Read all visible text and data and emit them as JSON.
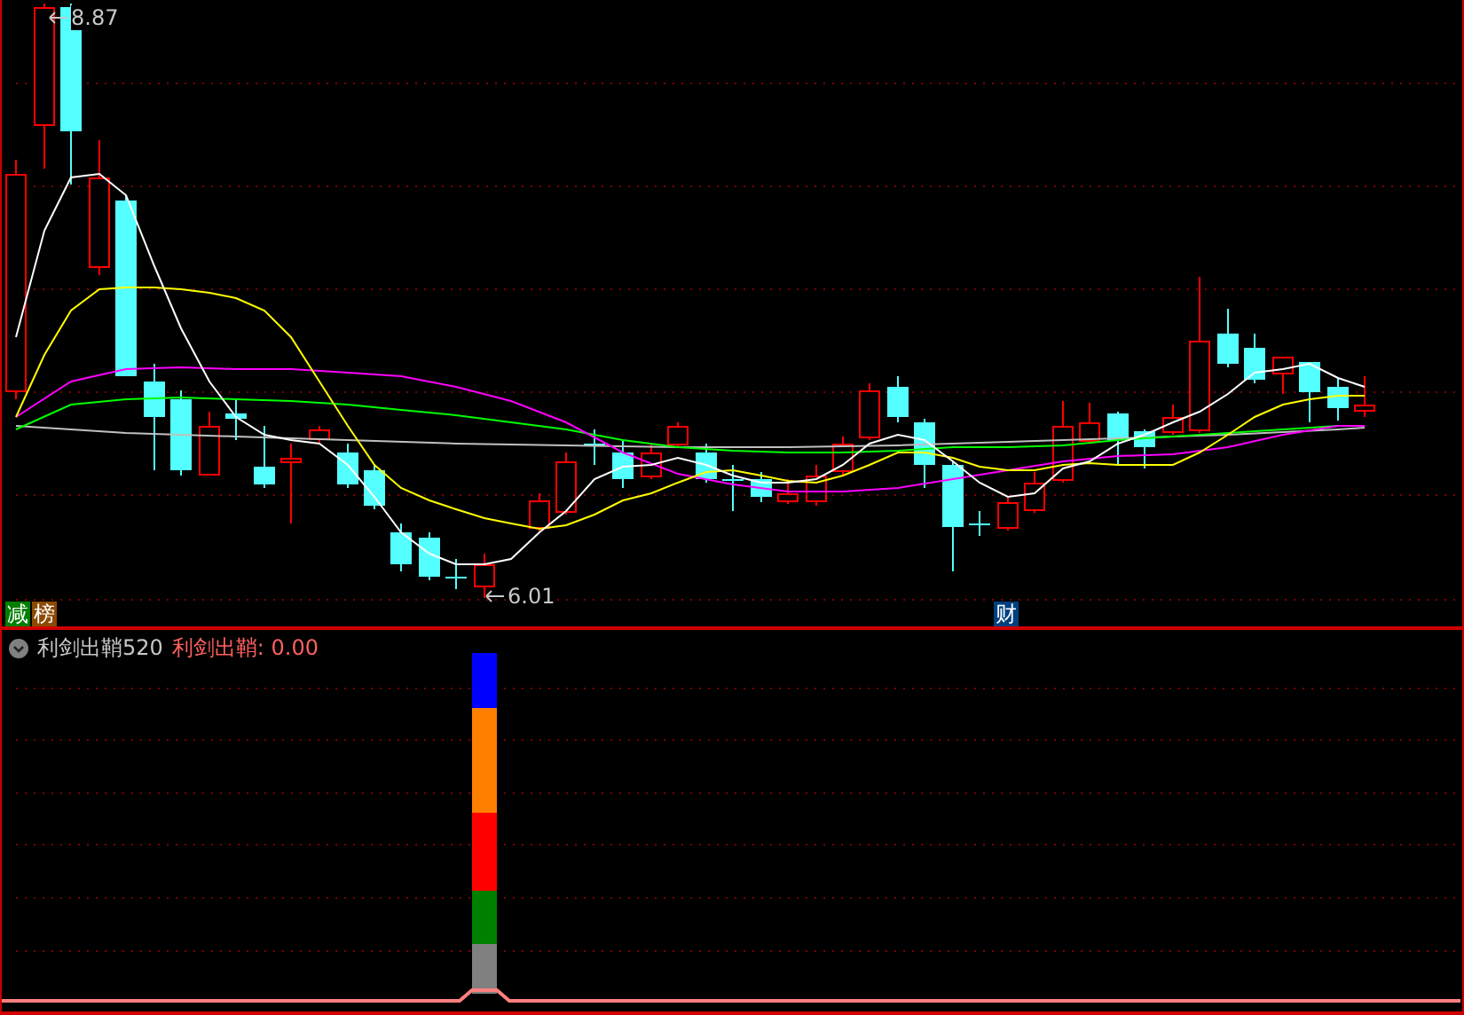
{
  "price_chart": {
    "high_label": "8.87",
    "low_label": "6.01",
    "badges": [
      {
        "text": "减",
        "color": "#007f00"
      },
      {
        "text": "榜",
        "color": "#8c4a00"
      }
    ],
    "event_marker": {
      "text": "财",
      "color": "#00407f"
    }
  },
  "indicator": {
    "name": "利剑出鞘520",
    "value_label": "利剑出鞘: 0.00",
    "stack": [
      {
        "color": "#0000ff"
      },
      {
        "color": "#ff8000"
      },
      {
        "color": "#ff0000"
      },
      {
        "color": "#008000"
      },
      {
        "color": "#808080"
      }
    ]
  }
}
